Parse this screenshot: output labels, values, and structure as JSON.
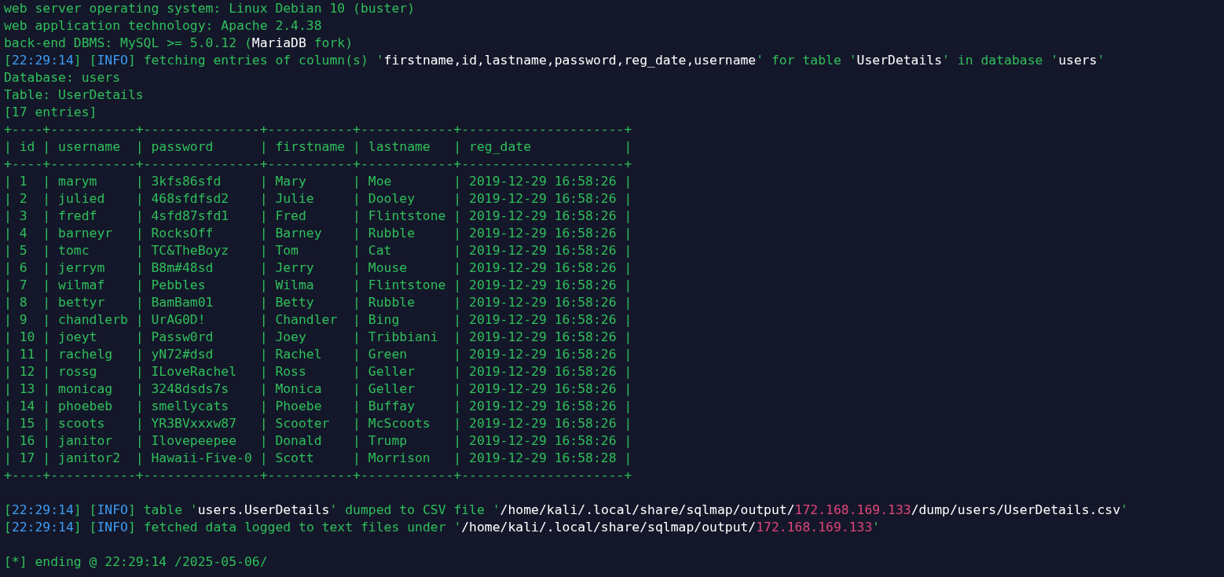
{
  "terminal": {
    "lines": [
      {
        "kind": "text",
        "segments": [
          {
            "text": "web server operating system: Linux Debian 10 (buster)",
            "kind": "normal"
          }
        ]
      },
      {
        "kind": "text",
        "segments": [
          {
            "text": "web application technology: Apache 2.4.38",
            "kind": "normal"
          }
        ]
      },
      {
        "kind": "text",
        "segments": [
          {
            "text": "back-end DBMS: MySQL >= 5.0.12 (",
            "kind": "normal"
          },
          {
            "text": "MariaDB",
            "kind": "highlight"
          },
          {
            "text": " fork)",
            "kind": "normal"
          }
        ]
      },
      {
        "kind": "text",
        "segments": [
          {
            "text": "[",
            "kind": "normal"
          },
          {
            "text": "22:29:14",
            "kind": "info"
          },
          {
            "text": "] [",
            "kind": "normal"
          },
          {
            "text": "INFO",
            "kind": "info"
          },
          {
            "text": "] fetching entries of column(s) '",
            "kind": "normal"
          },
          {
            "text": "firstname,id,lastname,password,reg_date,username",
            "kind": "highlight"
          },
          {
            "text": "' for table '",
            "kind": "normal"
          },
          {
            "text": "UserDetails",
            "kind": "highlight"
          },
          {
            "text": "' in database '",
            "kind": "normal"
          },
          {
            "text": "users",
            "kind": "highlight"
          },
          {
            "text": "'",
            "kind": "normal"
          }
        ]
      },
      {
        "kind": "text",
        "segments": [
          {
            "text": "Database: users",
            "kind": "normal"
          }
        ]
      },
      {
        "kind": "text",
        "segments": [
          {
            "text": "Table: UserDetails",
            "kind": "normal"
          }
        ]
      },
      {
        "kind": "text",
        "segments": [
          {
            "text": "[17 entries]",
            "kind": "normal"
          }
        ]
      },
      {
        "kind": "text",
        "segments": [
          {
            "text": "+----+-----------+---------------+-----------+------------+---------------------+",
            "kind": "normal"
          }
        ]
      },
      {
        "kind": "text",
        "segments": [
          {
            "text": "| id | username  | password      | firstname | lastname   | reg_date            |",
            "kind": "normal"
          }
        ]
      },
      {
        "kind": "text",
        "segments": [
          {
            "text": "+----+-----------+---------------+-----------+------------+---------------------+",
            "kind": "normal"
          }
        ]
      },
      {
        "kind": "text",
        "segments": [
          {
            "text": "| 1  | marym     | 3kfs86sfd     | Mary      | Moe        | 2019-12-29 16:58:26 |",
            "kind": "normal"
          }
        ]
      },
      {
        "kind": "text",
        "segments": [
          {
            "text": "| 2  | julied    | 468sfdfsd2    | Julie     | Dooley     | 2019-12-29 16:58:26 |",
            "kind": "normal"
          }
        ]
      },
      {
        "kind": "text",
        "segments": [
          {
            "text": "| 3  | fredf     | 4sfd87sfd1    | Fred      | Flintstone | 2019-12-29 16:58:26 |",
            "kind": "normal"
          }
        ]
      },
      {
        "kind": "text",
        "segments": [
          {
            "text": "| 4  | barneyr   | RocksOff      | Barney    | Rubble     | 2019-12-29 16:58:26 |",
            "kind": "normal"
          }
        ]
      },
      {
        "kind": "text",
        "segments": [
          {
            "text": "| 5  | tomc      | TC&TheBoyz    | Tom       | Cat        | 2019-12-29 16:58:26 |",
            "kind": "normal"
          }
        ]
      },
      {
        "kind": "text",
        "segments": [
          {
            "text": "| 6  | jerrym    | B8m#48sd      | Jerry     | Mouse      | 2019-12-29 16:58:26 |",
            "kind": "normal"
          }
        ]
      },
      {
        "kind": "text",
        "segments": [
          {
            "text": "| 7  | wilmaf    | Pebbles       | Wilma     | Flintstone | 2019-12-29 16:58:26 |",
            "kind": "normal"
          }
        ]
      },
      {
        "kind": "text",
        "segments": [
          {
            "text": "| 8  | bettyr    | BamBam01      | Betty     | Rubble     | 2019-12-29 16:58:26 |",
            "kind": "normal"
          }
        ]
      },
      {
        "kind": "text",
        "segments": [
          {
            "text": "| 9  | chandlerb | UrAG0D!       | Chandler  | Bing       | 2019-12-29 16:58:26 |",
            "kind": "normal"
          }
        ]
      },
      {
        "kind": "text",
        "segments": [
          {
            "text": "| 10 | joeyt     | Passw0rd      | Joey      | Tribbiani  | 2019-12-29 16:58:26 |",
            "kind": "normal"
          }
        ]
      },
      {
        "kind": "text",
        "segments": [
          {
            "text": "| 11 | rachelg   | yN72#dsd      | Rachel    | Green      | 2019-12-29 16:58:26 |",
            "kind": "normal"
          }
        ]
      },
      {
        "kind": "text",
        "segments": [
          {
            "text": "| 12 | rossg     | ILoveRachel   | Ross      | Geller     | 2019-12-29 16:58:26 |",
            "kind": "normal"
          }
        ]
      },
      {
        "kind": "text",
        "segments": [
          {
            "text": "| 13 | monicag   | 3248dsds7s    | Monica    | Geller     | 2019-12-29 16:58:26 |",
            "kind": "normal"
          }
        ]
      },
      {
        "kind": "text",
        "segments": [
          {
            "text": "| 14 | phoebeb   | smellycats    | Phoebe    | Buffay     | 2019-12-29 16:58:26 |",
            "kind": "normal"
          }
        ]
      },
      {
        "kind": "text",
        "segments": [
          {
            "text": "| 15 | scoots    | YR3BVxxxw87   | Scooter   | McScoots   | 2019-12-29 16:58:26 |",
            "kind": "normal"
          }
        ]
      },
      {
        "kind": "text",
        "segments": [
          {
            "text": "| 16 | janitor   | Ilovepeepee   | Donald    | Trump      | 2019-12-29 16:58:26 |",
            "kind": "normal"
          }
        ]
      },
      {
        "kind": "text",
        "segments": [
          {
            "text": "| 17 | janitor2  | Hawaii-Five-0 | Scott     | Morrison   | 2019-12-29 16:58:28 |",
            "kind": "normal"
          }
        ]
      },
      {
        "kind": "text",
        "segments": [
          {
            "text": "+----+-----------+---------------+-----------+------------+---------------------+",
            "kind": "normal"
          }
        ]
      },
      {
        "kind": "blank"
      },
      {
        "kind": "text",
        "segments": [
          {
            "text": "[",
            "kind": "normal"
          },
          {
            "text": "22:29:14",
            "kind": "info"
          },
          {
            "text": "] [",
            "kind": "normal"
          },
          {
            "text": "INFO",
            "kind": "info"
          },
          {
            "text": "] table '",
            "kind": "normal"
          },
          {
            "text": "users.UserDetails",
            "kind": "highlight"
          },
          {
            "text": "' dumped to CSV file '",
            "kind": "normal"
          },
          {
            "text": "/home/kali/.local/share/sqlmap/output/",
            "kind": "highlight"
          },
          {
            "text": "172.168.169.133",
            "kind": "address"
          },
          {
            "text": "/dump/users/UserDetails.csv",
            "kind": "highlight"
          },
          {
            "text": "'",
            "kind": "normal"
          }
        ]
      },
      {
        "kind": "text",
        "segments": [
          {
            "text": "[",
            "kind": "normal"
          },
          {
            "text": "22:29:14",
            "kind": "info"
          },
          {
            "text": "] [",
            "kind": "normal"
          },
          {
            "text": "INFO",
            "kind": "info"
          },
          {
            "text": "] fetched data logged to text files under '",
            "kind": "normal"
          },
          {
            "text": "/home/kali/.local/share/sqlmap/output/",
            "kind": "highlight"
          },
          {
            "text": "172.168.169.133",
            "kind": "address"
          },
          {
            "text": "'",
            "kind": "normal"
          }
        ]
      },
      {
        "kind": "blank"
      },
      {
        "kind": "text",
        "segments": [
          {
            "text": "[*] ending @ 22:29:14 /2025-05-06/",
            "kind": "normal"
          }
        ]
      }
    ]
  }
}
